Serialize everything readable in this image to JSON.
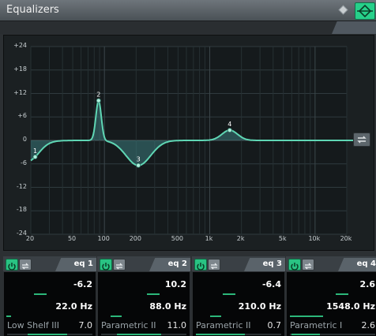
{
  "window": {
    "title": "Equalizers",
    "accent_color": "#27d08a"
  },
  "graph": {
    "y_labels": [
      "+24",
      "+18",
      "+12",
      "+6",
      "0",
      "-6",
      "-12",
      "-18",
      "-24"
    ],
    "x_labels": [
      "20",
      "50",
      "100",
      "200",
      "500",
      "1k",
      "2k",
      "5k",
      "10k",
      "20k"
    ],
    "node_labels": [
      "1",
      "2",
      "3",
      "4"
    ],
    "curve_color": "#5fd6b4",
    "fill_color": "#3d7b7d"
  },
  "bands": [
    {
      "tab": "eq 1",
      "gain": "-6.2",
      "freq": "22.0 Hz",
      "type": "Low Shelf III",
      "q": "7.0"
    },
    {
      "tab": "eq 2",
      "gain": "10.2",
      "freq": "88.0 Hz",
      "type": "Parametric II",
      "q": "11.0"
    },
    {
      "tab": "eq 3",
      "gain": "-6.4",
      "freq": "210.0 Hz",
      "type": "Parametric II",
      "q": "0.7"
    },
    {
      "tab": "eq 4",
      "gain": "2.6",
      "freq": "1548.0 Hz",
      "type": "Parametric I",
      "q": "2.6"
    }
  ]
}
